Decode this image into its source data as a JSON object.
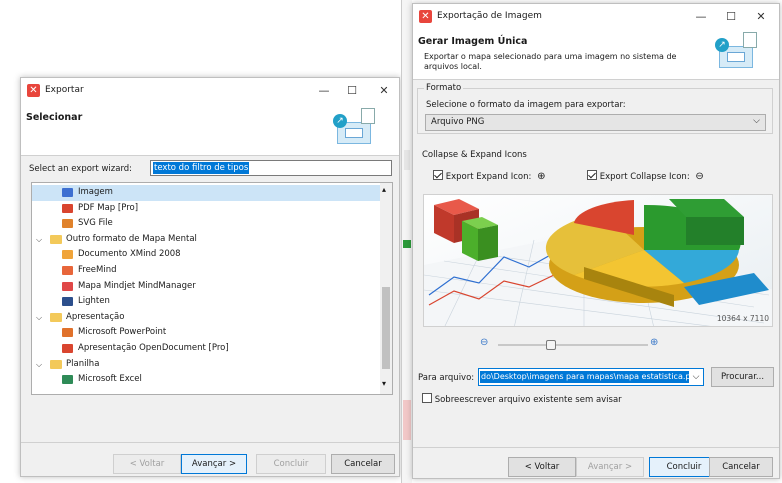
{
  "left_dialog": {
    "title": "Exportar",
    "header_title": "Selecionar",
    "filter_label": "Select an export wizard:",
    "filter_value": "texto do filtro de tipos",
    "tree": [
      {
        "label": "Imagem",
        "indent": 2,
        "icon_color": "#3d6fd1",
        "selected": true
      },
      {
        "label": "PDF Map [Pro]",
        "indent": 2,
        "icon_color": "#d9452f"
      },
      {
        "label": "SVG File",
        "indent": 2,
        "icon_color": "#e0822b"
      },
      {
        "label": "Outro formato de Mapa Mental",
        "indent": 0,
        "folder": true
      },
      {
        "label": "Documento XMind 2008",
        "indent": 2,
        "icon_color": "#f0a43a"
      },
      {
        "label": "FreeMind",
        "indent": 2,
        "icon_color": "#e8663a"
      },
      {
        "label": "Mapa Mindjet MindManager",
        "indent": 2,
        "icon_color": "#e04848"
      },
      {
        "label": "Lighten",
        "indent": 2,
        "icon_color": "#2c4f8c"
      },
      {
        "label": "Apresentação",
        "indent": 0,
        "folder": true
      },
      {
        "label": "Microsoft PowerPoint",
        "indent": 2,
        "icon_color": "#e0712b"
      },
      {
        "label": "Apresentação OpenDocument [Pro]",
        "indent": 2,
        "icon_color": "#d9452f"
      },
      {
        "label": "Planilha",
        "indent": 0,
        "folder": true
      },
      {
        "label": "Microsoft Excel",
        "indent": 2,
        "icon_color": "#2e8b57"
      }
    ],
    "buttons": {
      "back": "< Voltar",
      "next": "Avançar >",
      "finish": "Concluir",
      "cancel": "Cancelar"
    }
  },
  "right_dialog": {
    "title": "Exportação de Imagem",
    "header_title": "Gerar Imagem Única",
    "header_desc": "Exportar o mapa selecionado para uma imagem no sistema de arquivos local.",
    "format_group": "Formato",
    "format_label": "Selecione o formato da imagem para exportar:",
    "format_value": "Arquivo PNG",
    "collapse_title": "Collapse & Expand Icons",
    "export_expand": "Export Expand Icon:",
    "export_collapse": "Export Collapse Icon:",
    "expand_checked": true,
    "collapse_checked": true,
    "image_size": "10364 x 7110",
    "zoom_level": 0.35,
    "file_label": "Para arquivo:",
    "file_value": "do\\Desktop\\imagens para mapas\\mapa estatistica.png",
    "browse": "Procurar...",
    "overwrite": "Sobreescrever arquivo existente sem avisar",
    "overwrite_checked": false,
    "buttons": {
      "back": "< Voltar",
      "next": "Avançar >",
      "finish": "Concluir",
      "cancel": "Cancelar"
    }
  },
  "colors": {
    "selection": "#cce4f7",
    "accent": "#0078d7",
    "brand": "#e8453c"
  }
}
